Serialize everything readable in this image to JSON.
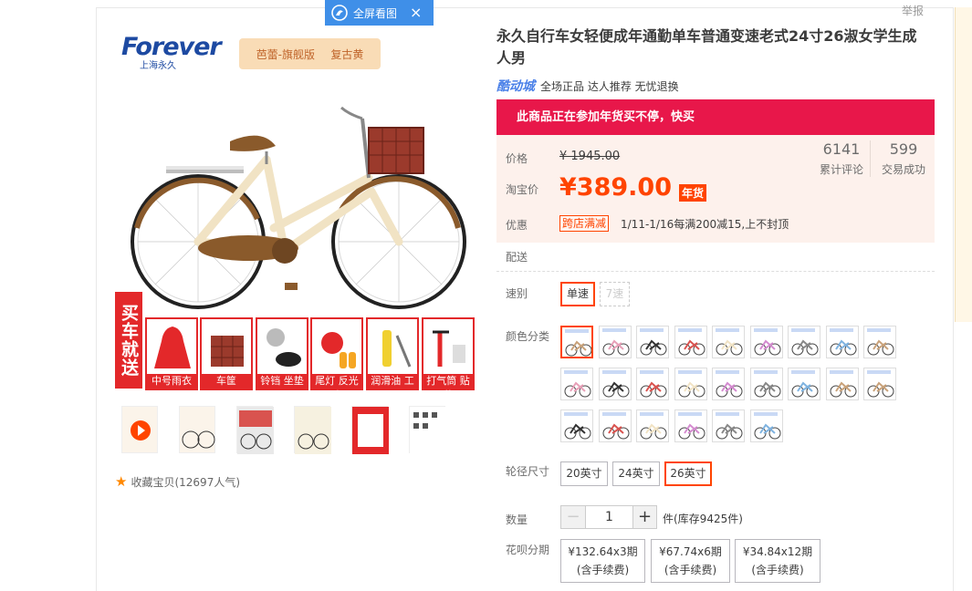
{
  "toolbar": {
    "report_label": "举报",
    "fullscreen_label": "全屏看图",
    "close_symbol": "×"
  },
  "gallery": {
    "brand_word": "Forever",
    "brand_sub": "上海永久",
    "ribbon": [
      "芭蕾-旗舰版",
      "复古黄"
    ],
    "buy_send_label": "买车就送",
    "accessories": [
      "中号雨衣",
      "车筐",
      "铃铛 坐垫",
      "尾灯 反光片",
      "润滑油 工具",
      "打气筒 贴花"
    ],
    "favorite_label": "收藏宝贝",
    "favorite_count": "(12697人气)"
  },
  "product": {
    "title": "永久自行车女轻便成年通勤单车普通变速老式24寸26淑女学生成人男",
    "platform": "酷动城",
    "tagline": "全场正品 达人推荐 无忧退换",
    "banner": "此商品正在参加年货买不停，快买"
  },
  "pricing": {
    "price_label": "价格",
    "original_price": "¥ 1945.00",
    "taobao_label": "淘宝价",
    "current_price": "¥389.00",
    "badge": "年货",
    "reviews_count": "6141",
    "reviews_label": "累计评论",
    "sales_count": "599",
    "sales_label": "交易成功",
    "promo_label": "优惠",
    "promo_tag": "跨店满减",
    "promo_text": "1/11-1/16每满200减15,上不封顶",
    "delivery_label": "配送"
  },
  "options": {
    "speed_label": "速别",
    "speeds": [
      {
        "label": "单速",
        "state": "selected"
      },
      {
        "label": "7速",
        "state": "disabled"
      }
    ],
    "color_label": "颜色分类",
    "wheel_label": "轮径尺寸",
    "wheels": [
      {
        "label": "20英寸",
        "state": "normal"
      },
      {
        "label": "24英寸",
        "state": "normal"
      },
      {
        "label": "26英寸",
        "state": "selected"
      }
    ],
    "qty_label": "数量",
    "qty_minus": "−",
    "qty_value": "1",
    "qty_plus": "+",
    "stock": "件(库存9425件)",
    "installment_label": "花呗分期",
    "installments": [
      {
        "amount": "¥132.64x3期",
        "note": "(含手续费)"
      },
      {
        "amount": "¥67.74x6期",
        "note": "(含手续费)"
      },
      {
        "amount": "¥34.84x12期",
        "note": "(含手续费)"
      }
    ]
  },
  "colors": {
    "bike_accent": "#8a5a2b",
    "frame_cream": "#f1e3c4",
    "basket_red": "#9b3a2c",
    "price_orange": "#ff4400",
    "banner_pink": "#e8174a",
    "selected_border": "#ff4400"
  }
}
